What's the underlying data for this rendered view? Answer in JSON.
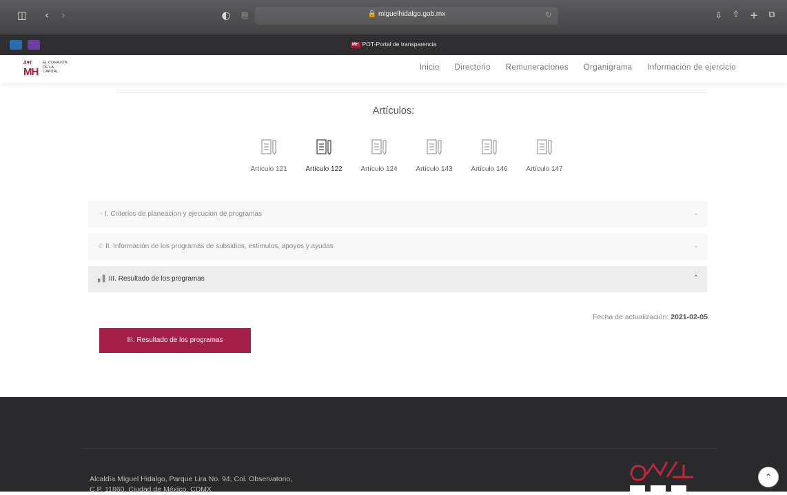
{
  "browser": {
    "url": "miguelhidalgo.gob.mx",
    "tab_title": "POT-Portal de transparencia",
    "tab_favicon": "MH",
    "icons": [
      "sidebar-icon",
      "back-icon",
      "forward-icon",
      "privacy-icon",
      "reader-icon",
      "lock-icon",
      "reload-icon",
      "download-icon",
      "share-icon",
      "new-tab-icon",
      "tabs-icon"
    ]
  },
  "header": {
    "logo_top": "à♥t",
    "logo_mh": "MH",
    "logo_line1": "EL CORAZÓN",
    "logo_line2": "DE LA",
    "logo_line3": "CAPITAL",
    "nav": [
      {
        "label": "Inicio"
      },
      {
        "label": "Directorio"
      },
      {
        "label": "Remuneraciones"
      },
      {
        "label": "Organigrama"
      },
      {
        "label": "Información de ejercicio"
      }
    ]
  },
  "main": {
    "articulos_title": "Artículos:",
    "articles": [
      {
        "label": "Artículo 121",
        "active": false
      },
      {
        "label": "Artículo 122",
        "active": true
      },
      {
        "label": "Artículo 124",
        "active": false
      },
      {
        "label": "Artículo 143",
        "active": false
      },
      {
        "label": "Artículo 146",
        "active": false
      },
      {
        "label": "Artículo 147",
        "active": false
      }
    ],
    "accordion": [
      {
        "label": "I. Criterios de planeacion y ejecucion de programas",
        "icon": "☞",
        "open": false,
        "chevron": "⌄"
      },
      {
        "label": "II. Información de los programas de subsidios, estímulos, apoyos y ayudas",
        "icon": "©",
        "open": false,
        "chevron": "⌄"
      },
      {
        "label": "III. Resultado de los programas",
        "icon": "▖▌",
        "open": true,
        "chevron": "⌃"
      }
    ],
    "fecha_label": "Fecha de actualización:",
    "fecha_value": "2021-02-05",
    "result_button": "III. Resultado de los programas"
  },
  "footer": {
    "address_line1": "Alcaldía Miguel Hidalgo, Parque Lira No. 94, Col. Observatorio,",
    "address_line2": "C.P. 11860, Ciudad de México, CDMX"
  },
  "colors": {
    "accent": "#a31f4a",
    "footer_bg": "#2a2a2c",
    "accordion_bg": "#f7f7f7"
  }
}
